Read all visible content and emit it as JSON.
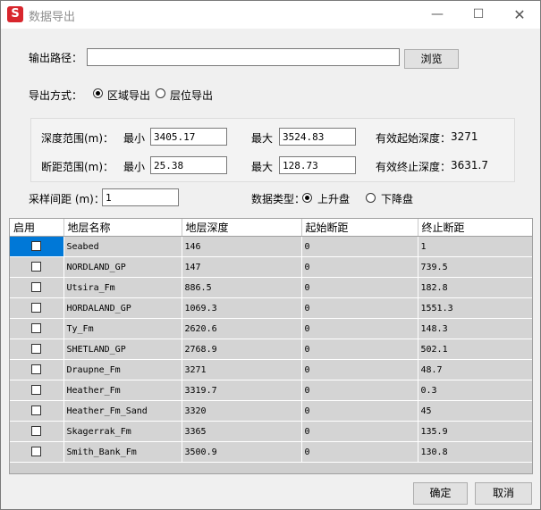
{
  "window": {
    "title": "数据导出",
    "app_icon": "S",
    "minimize_glyph": "—",
    "maximize_glyph": "☐",
    "close_glyph": "✕"
  },
  "output_path": {
    "label": "输出路径：",
    "value": "",
    "browse_label": "浏览"
  },
  "export_mode": {
    "label": "导出方式：",
    "options": [
      {
        "label": "区域导出",
        "selected": true
      },
      {
        "label": "层位导出",
        "selected": false
      }
    ]
  },
  "range": {
    "depth": {
      "label": "深度范围(m)：",
      "min_label": "最小",
      "min": "3405.17",
      "max_label": "最大",
      "max": "3524.83",
      "info_label": "有效起始深度：",
      "info_value": "3271"
    },
    "offset": {
      "label": "断距范围(m)：",
      "min_label": "最小",
      "min": "25.38",
      "max_label": "最大",
      "max": "128.73",
      "info_label": "有效终止深度：",
      "info_value": "3631.7"
    }
  },
  "sample_interval": {
    "label": "采样间距 (m)：",
    "value": "1"
  },
  "data_type": {
    "label": "数据类型：",
    "options": [
      {
        "label": "上升盘",
        "selected": true
      },
      {
        "label": "下降盘",
        "selected": false
      }
    ]
  },
  "table": {
    "columns": [
      "启用",
      "地层名称",
      "地层深度",
      "起始断距",
      "终止断距"
    ],
    "rows": [
      {
        "enabled": false,
        "name": "Seabed",
        "depth": "146",
        "start": "0",
        "end": "1"
      },
      {
        "enabled": false,
        "name": "NORDLAND_GP",
        "depth": "147",
        "start": "0",
        "end": "739.5"
      },
      {
        "enabled": false,
        "name": "Utsira_Fm",
        "depth": "886.5",
        "start": "0",
        "end": "182.8"
      },
      {
        "enabled": false,
        "name": "HORDALAND_GP",
        "depth": "1069.3",
        "start": "0",
        "end": "1551.3"
      },
      {
        "enabled": false,
        "name": "Ty_Fm",
        "depth": "2620.6",
        "start": "0",
        "end": "148.3"
      },
      {
        "enabled": false,
        "name": "SHETLAND_GP",
        "depth": "2768.9",
        "start": "0",
        "end": "502.1"
      },
      {
        "enabled": false,
        "name": "Draupne_Fm",
        "depth": "3271",
        "start": "0",
        "end": "48.7"
      },
      {
        "enabled": false,
        "name": "Heather_Fm",
        "depth": "3319.7",
        "start": "0",
        "end": "0.3"
      },
      {
        "enabled": false,
        "name": "Heather_Fm_Sand",
        "depth": "3320",
        "start": "0",
        "end": "45"
      },
      {
        "enabled": false,
        "name": "Skagerrak_Fm",
        "depth": "3365",
        "start": "0",
        "end": "135.9"
      },
      {
        "enabled": false,
        "name": "Smith_Bank_Fm",
        "depth": "3500.9",
        "start": "0",
        "end": "130.8"
      }
    ]
  },
  "footer": {
    "ok_label": "确定",
    "cancel_label": "取消"
  }
}
